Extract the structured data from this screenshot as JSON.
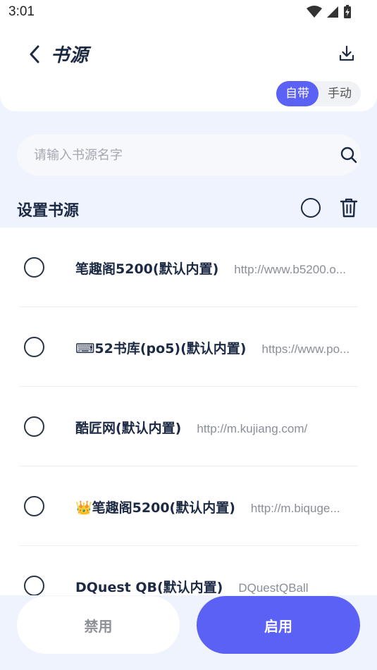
{
  "status_bar": {
    "time": "3:01"
  },
  "header": {
    "title": "书源"
  },
  "mode_toggle": {
    "auto_label": "自带",
    "manual_label": "手动",
    "selected": "自带"
  },
  "search": {
    "placeholder": "请输入书源名字",
    "value": ""
  },
  "section": {
    "title": "设置书源"
  },
  "sources": [
    {
      "name": "笔趣阁5200(默认内置)",
      "url": "http://www.b5200.o..."
    },
    {
      "name": "⌨52书库(po5)(默认内置)",
      "url": "https://www.po..."
    },
    {
      "name": "酷匠网(默认内置)",
      "url": "http://m.kujiang.com/"
    },
    {
      "name": "👑笔趣阁5200(默认内置)",
      "url": "http://m.biquge..."
    },
    {
      "name": "DQuest QB(默认内置)",
      "url": "DQuestQBall"
    }
  ],
  "actions": {
    "disable_label": "禁用",
    "enable_label": "启用"
  },
  "colors": {
    "accent": "#5b61f4",
    "page_bg": "#eff3fd",
    "text_dark": "#1d2a44",
    "text_muted": "#8a8e98"
  }
}
